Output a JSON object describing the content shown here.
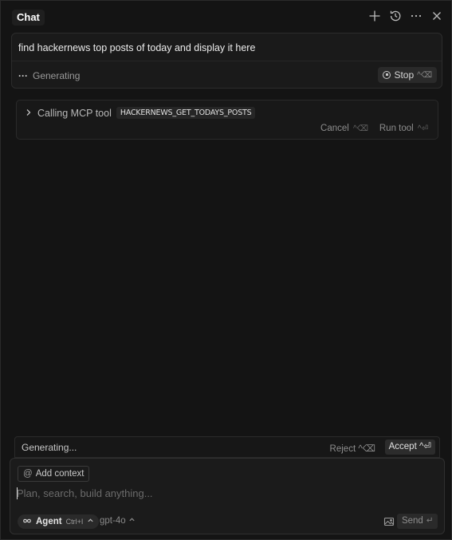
{
  "header": {
    "title": "Chat",
    "icons": [
      "plus-icon",
      "history-icon",
      "more-icon",
      "close-icon"
    ]
  },
  "user_message": {
    "text": "find hackernews top posts of today and display it here",
    "status_dots": "···",
    "status": "Generating",
    "stop_label": "Stop",
    "stop_shortcut": "^⌫"
  },
  "tool_call": {
    "label": "Calling MCP tool",
    "tool_name": "HACKERNEWS_GET_TODAYS_POSTS",
    "cancel_label": "Cancel",
    "cancel_shortcut": "^⌫",
    "run_label": "Run tool",
    "run_shortcut": "^⏎"
  },
  "generating_bar": {
    "text": "Generating...",
    "reject_label": "Reject ^⌫",
    "accept_label": "Accept ^⏎"
  },
  "composer": {
    "add_context_label": "Add context",
    "placeholder": "Plan, search, build anything...",
    "agent_label": "Agent",
    "agent_shortcut": "Ctrl+I",
    "model": "gpt-4o",
    "send_label": "Send"
  },
  "colors": {
    "background": "#141414",
    "panel_border": "#2b2b2b"
  }
}
